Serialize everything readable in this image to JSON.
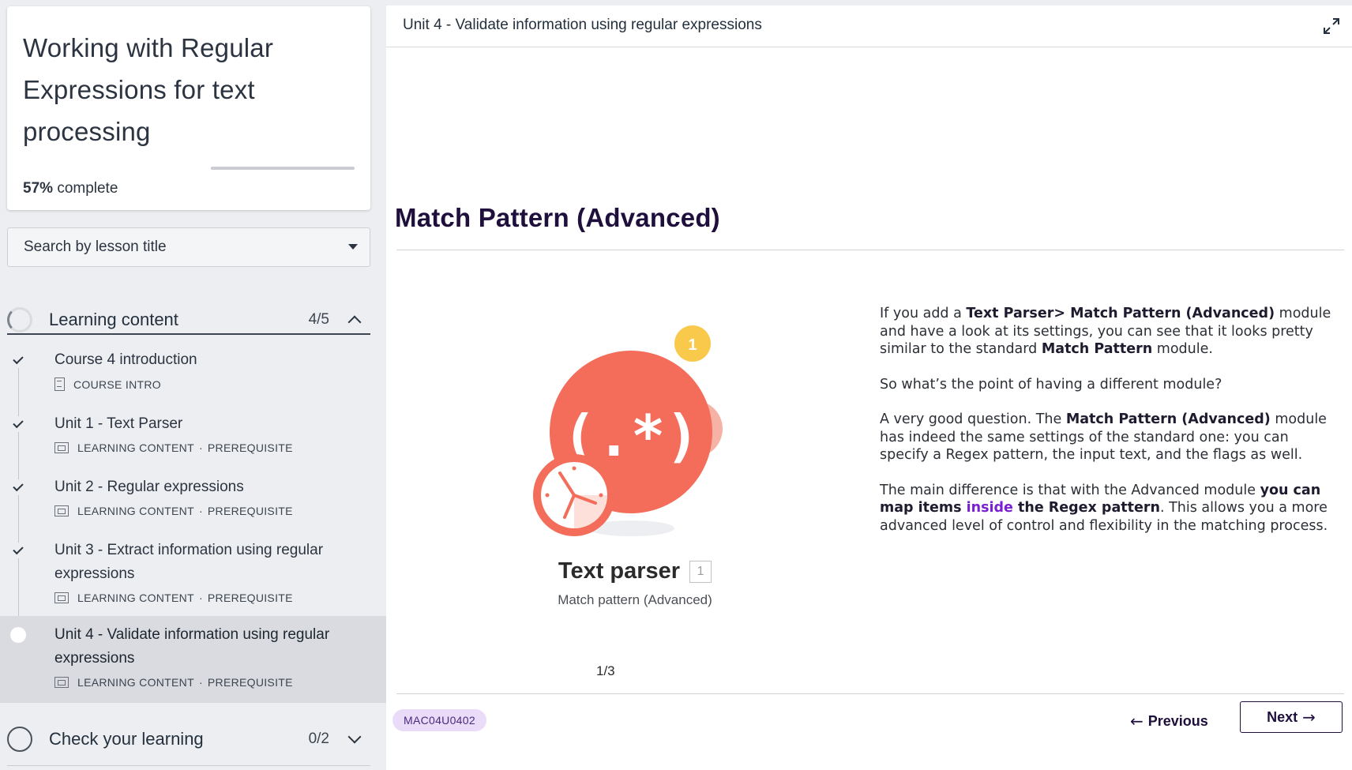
{
  "sidebar": {
    "course_title": "Working with Regular Expressions for text processing",
    "progress_percent": "57%",
    "progress_suffix": "complete",
    "progress_value": 0.57,
    "search_placeholder": "Search by lesson title",
    "sections": [
      {
        "label": "Learning content",
        "count": "4/5",
        "state": "expanded"
      },
      {
        "label": "Check your learning",
        "count": "0/2",
        "state": "collapsed"
      }
    ],
    "lessons": [
      {
        "title": "Course 4 introduction",
        "type": "COURSE INTRO",
        "tag": "",
        "completed": true,
        "icon": "document-icon"
      },
      {
        "title": "Unit 1 - Text Parser",
        "type": "LEARNING CONTENT",
        "tag": "PREREQUISITE",
        "completed": true,
        "icon": "screen-icon"
      },
      {
        "title": "Unit 2 - Regular expressions",
        "type": "LEARNING CONTENT",
        "tag": "PREREQUISITE",
        "completed": true,
        "icon": "screen-icon"
      },
      {
        "title": "Unit 3 - Extract information using regular expressions",
        "type": "LEARNING CONTENT",
        "tag": "PREREQUISITE",
        "completed": true,
        "icon": "screen-icon"
      },
      {
        "title": "Unit 4 - Validate information using regular expressions",
        "type": "LEARNING CONTENT",
        "tag": "PREREQUISITE",
        "completed": false,
        "active": true,
        "icon": "screen-icon"
      }
    ],
    "meta_separator": "·"
  },
  "main": {
    "header_title": "Unit 4 - Validate information using regular expressions",
    "heading": "Match Pattern (Advanced)",
    "illustration": {
      "notification_count": "1",
      "symbol": "(.*)",
      "app_name": "Text parser",
      "app_badge": "1",
      "app_subtitle": "Match pattern (Advanced)"
    },
    "slide_counter": "1/3",
    "paragraphs": {
      "p1_a": "If you add a ",
      "p1_b": "Text Parser> Match Pattern (Advanced)",
      "p1_c": " module and have a look at its settings, you can see that it looks pretty similar to the standard ",
      "p1_d": "Match Pattern",
      "p1_e": " module.",
      "p2": "So what’s the point of having a different module?",
      "p3_a": "A very good question. The ",
      "p3_b": "Match Pattern (Advanced)",
      "p3_c": " module has indeed the same settings of the standard one: you can specify a Regex pattern, the input text, and the flags as well.",
      "p4_a": "The main difference is that with the Advanced module ",
      "p4_b": "you can map items ",
      "p4_c": "inside",
      "p4_d": " the Regex pattern",
      "p4_e": ". This allows you a more advanced level of control and flexibility in the matching process."
    },
    "footer": {
      "code": "MAC04U0402",
      "previous_label": "Previous",
      "next_label": "Next"
    }
  },
  "colors": {
    "heading": "#1e0f3c",
    "accent_purple": "#7a1fd1",
    "pill_bg": "#eadcf8",
    "coral": "#f36d5a",
    "badge_yellow": "#f8c94a"
  }
}
